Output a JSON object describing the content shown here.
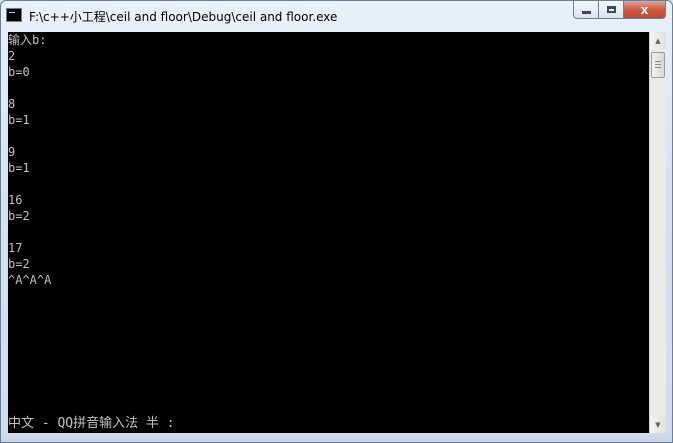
{
  "window": {
    "title": "F:\\c++小工程\\ceil and floor\\Debug\\ceil and floor.exe",
    "icon": "console-app-icon",
    "controls": {
      "minimize": "minimize",
      "maximize": "maximize",
      "close": "x"
    }
  },
  "console": {
    "lines": [
      "输入b:",
      "2",
      "b=0",
      "",
      "8",
      "b=1",
      "",
      "9",
      "b=1",
      "",
      "16",
      "b=2",
      "",
      "17",
      "b=2",
      "^A^A^A"
    ],
    "ime_status": "中文 - QQ拼音输入法 半 :",
    "colors": {
      "background": "#000000",
      "text": "#c0c0c0"
    }
  },
  "scrollbar": {
    "up_arrow": "▲",
    "down_arrow": "▼"
  }
}
